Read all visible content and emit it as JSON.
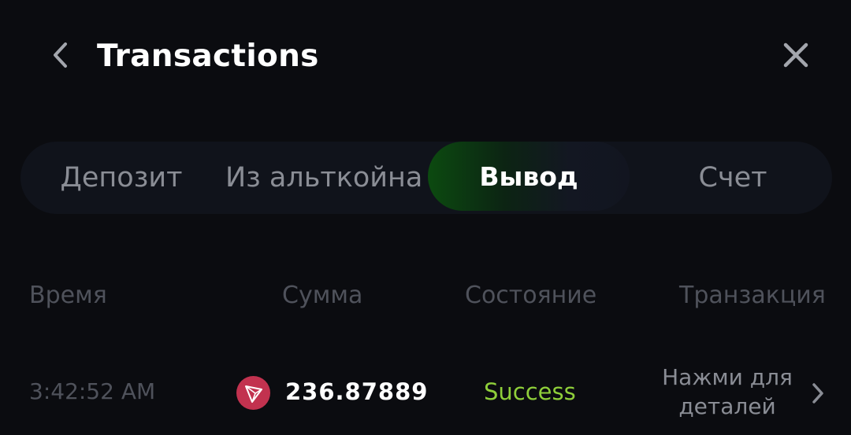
{
  "header": {
    "title": "Transactions",
    "back_icon": "chevron-left-icon",
    "close_icon": "close-icon"
  },
  "tabs": [
    {
      "label": "Депозит",
      "active": false
    },
    {
      "label": "Из альткойна",
      "active": false
    },
    {
      "label": "Вывод",
      "active": true
    },
    {
      "label": "Счет",
      "active": false
    }
  ],
  "table": {
    "columns": [
      "Время",
      "Сумма",
      "Состояние",
      "Транзакция"
    ],
    "rows": [
      {
        "time": "3:42:52 AM",
        "coin_icon": "tron-icon",
        "amount": "236.878896",
        "status": "Success",
        "details": "Нажми для деталей"
      }
    ]
  },
  "colors": {
    "background": "#0b0c10",
    "success": "#8fcf3a",
    "active_tab_accent": "#0c4a10",
    "coin": "#c2324f"
  }
}
